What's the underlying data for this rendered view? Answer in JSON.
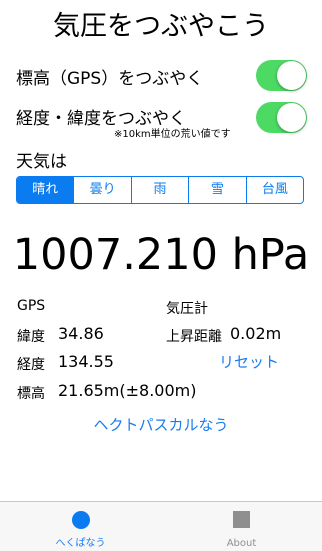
{
  "title": "気圧をつぶやこう",
  "settings": {
    "gps_label": "標高（GPS）をつぶやく",
    "latlng_label": "経度・緯度をつぶやく",
    "latlng_note": "※10km単位の荒い値です"
  },
  "weather": {
    "label": "天気は",
    "options": [
      "晴れ",
      "曇り",
      "雨",
      "雪",
      "台風"
    ],
    "selected": "晴れ"
  },
  "pressure": "1007.210 hPa",
  "gps": {
    "header": "GPS",
    "lat_label": "緯度",
    "lat_value": "34.86",
    "lng_label": "経度",
    "lng_value": "134.55",
    "alt_label": "標高",
    "alt_value": "21.65m(±8.00m)"
  },
  "barometer": {
    "header": "気圧計",
    "rise_label": "上昇距離",
    "rise_value": "0.02m",
    "reset_label": "リセット"
  },
  "action_label": "ヘクトパスカルなう",
  "tabs": {
    "home": "へくぱなう",
    "about": "About"
  },
  "colors": {
    "accent": "#0a7cf0",
    "toggle_on": "#4cd964"
  }
}
